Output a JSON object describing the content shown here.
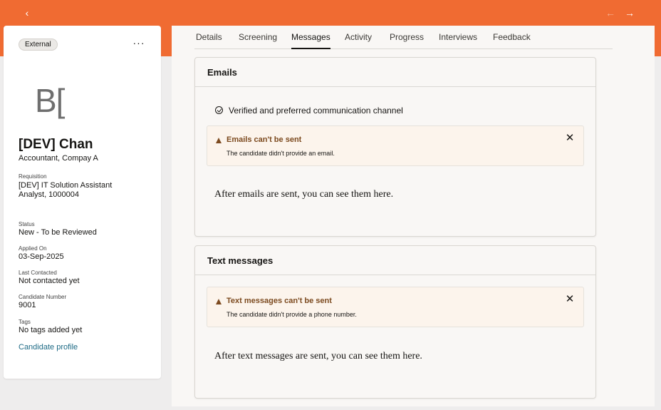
{
  "header": {
    "back_icon": "‹",
    "prev_icon": "←",
    "next_icon": "→"
  },
  "candidate": {
    "source_badge": "External",
    "more_icon": "···",
    "monogram": "B[",
    "name": "[DEV] Chan",
    "title": "Accountant, Compay A",
    "requisition_label": "Requisition",
    "requisition_line1": "[DEV] IT Solution Assistant",
    "requisition_line2": "Analyst, 1000004",
    "status_label": "Status",
    "status_value": "New - To be Reviewed",
    "applied_label": "Applied On",
    "applied_value": "03-Sep-2025",
    "last_contacted_label": "Last Contacted",
    "last_contacted_value": "Not contacted yet",
    "number_label": "Candidate Number",
    "number_value": "9001",
    "tags_label": "Tags",
    "tags_value": "No tags added yet",
    "profile_link": "Candidate profile"
  },
  "tabs": [
    "Details",
    "Screening",
    "Messages",
    "Activity",
    "Progress",
    "Interviews",
    "Feedback"
  ],
  "active_tab": "Messages",
  "emails": {
    "title": "Emails",
    "verified_text": "Verified and preferred communication channel",
    "warning_title": "Emails can't be sent",
    "warning_text": "The candidate didn't provide an email.",
    "close_icon": "✕",
    "empty_text": "After emails are sent, you can see them here."
  },
  "texts": {
    "title": "Text messages",
    "warning_title": "Text messages can't be sent",
    "warning_text": "The candidate didn't provide a phone number.",
    "close_icon": "✕",
    "empty_text": "After text messages are sent, you can see them here."
  },
  "colors": {
    "brand": "#f06b32",
    "warning": "#7c4a1f",
    "link": "#1d6a85"
  }
}
